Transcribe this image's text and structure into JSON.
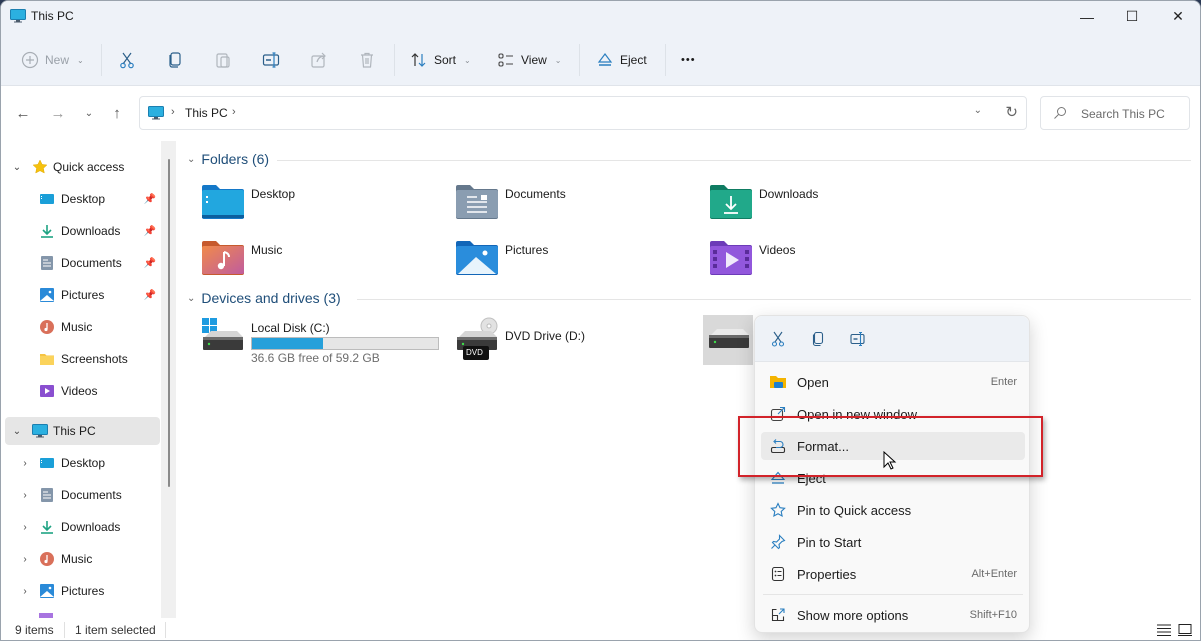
{
  "window": {
    "title": "This PC",
    "controls": {
      "minimize": "—",
      "maximize": "☐",
      "close": "✕"
    }
  },
  "toolbar": {
    "new_label": "New",
    "sort_label": "Sort",
    "view_label": "View",
    "eject_label": "Eject",
    "more_label": "•••",
    "icons": [
      "plus-circle-icon",
      "cut-icon",
      "copy-icon",
      "paste-icon",
      "rename-icon",
      "share-icon",
      "delete-icon",
      "sort-icon",
      "view-icon",
      "eject-icon",
      "more-icon"
    ]
  },
  "nav": {
    "back": "←",
    "forward": "→",
    "recent": "⌄",
    "up": "↑",
    "breadcrumb": [
      "This PC"
    ],
    "separator": "›",
    "dropdown": "⌄",
    "refresh": "↻",
    "search_placeholder": "Search This PC"
  },
  "sidebar": {
    "quick_access": {
      "label": "Quick access",
      "items": [
        {
          "label": "Desktop",
          "icon": "desktop-folder-icon",
          "pinned": true
        },
        {
          "label": "Downloads",
          "icon": "downloads-folder-icon",
          "pinned": true
        },
        {
          "label": "Documents",
          "icon": "documents-folder-icon",
          "pinned": true
        },
        {
          "label": "Pictures",
          "icon": "pictures-folder-icon",
          "pinned": true
        },
        {
          "label": "Music",
          "icon": "music-folder-icon",
          "pinned": false
        },
        {
          "label": "Screenshots",
          "icon": "folder-icon",
          "pinned": false
        },
        {
          "label": "Videos",
          "icon": "videos-folder-icon",
          "pinned": false
        }
      ]
    },
    "this_pc": {
      "label": "This PC",
      "selected": true,
      "items": [
        {
          "label": "Desktop",
          "icon": "desktop-folder-icon"
        },
        {
          "label": "Documents",
          "icon": "documents-folder-icon"
        },
        {
          "label": "Downloads",
          "icon": "downloads-folder-icon"
        },
        {
          "label": "Music",
          "icon": "music-folder-icon"
        },
        {
          "label": "Pictures",
          "icon": "pictures-folder-icon"
        }
      ]
    }
  },
  "content": {
    "folders_header": "Folders (6)",
    "folders": [
      {
        "name": "Desktop",
        "color": "#1a9fd8"
      },
      {
        "name": "Documents",
        "color": "#7f93a8"
      },
      {
        "name": "Downloads",
        "color": "#1fa383"
      },
      {
        "name": "Music",
        "color": "#e0734f"
      },
      {
        "name": "Pictures",
        "color": "#2a8ad8"
      },
      {
        "name": "Videos",
        "color": "#8a4fd0"
      }
    ],
    "drives_header": "Devices and drives (3)",
    "drives": [
      {
        "name": "Local Disk (C:)",
        "free_text": "36.6 GB free of 59.2 GB",
        "used_fraction": 0.382,
        "bar_color": "#26a0da"
      },
      {
        "name": "DVD Drive (D:)",
        "badge": "DVD"
      }
    ]
  },
  "context_menu": {
    "quick_actions": [
      "cut-icon",
      "copy-icon",
      "rename-icon"
    ],
    "items": [
      {
        "label": "Open",
        "shortcut": "Enter",
        "icon": "open-folder-icon"
      },
      {
        "label": "Open in new window",
        "shortcut": "",
        "icon": "new-window-icon"
      },
      {
        "label": "Format...",
        "shortcut": "",
        "icon": "format-icon",
        "hovered": true
      },
      {
        "label": "Eject",
        "shortcut": "",
        "icon": "eject-icon"
      },
      {
        "label": "Pin to Quick access",
        "shortcut": "",
        "icon": "star-icon"
      },
      {
        "label": "Pin to Start",
        "shortcut": "",
        "icon": "pin-icon"
      },
      {
        "label": "Properties",
        "shortcut": "Alt+Enter",
        "icon": "properties-icon"
      },
      {
        "label": "Show more options",
        "shortcut": "Shift+F10",
        "icon": "more-options-icon"
      }
    ]
  },
  "status": {
    "item_count": "9 items",
    "selection": "1 item selected"
  },
  "colors": {
    "accent": "#0067c0",
    "highlight_box": "#d2232a",
    "drive_bar": "#26a0da"
  }
}
